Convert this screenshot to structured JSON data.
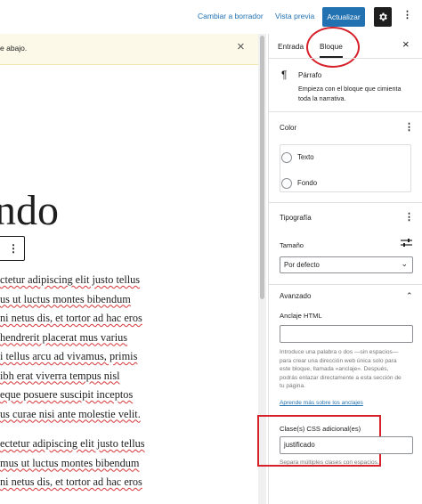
{
  "topbar": {
    "switch_draft": "Cambiar a borrador",
    "preview": "Vista previa",
    "update": "Actualizar"
  },
  "notice": {
    "text": "e abajo.",
    "close": "×"
  },
  "editor": {
    "heading": "ndo",
    "paragraph1": [
      "ctetur adipiscing elit justo tellus",
      "us ut luctus montes bibendum",
      "ni netus dis, et tortor ad hac eros",
      " hendrerit placerat mus varius",
      "i tellus arcu ad vivamus, primis",
      "ibh erat viverra tempus nisl",
      "eque posuere suscipit inceptos",
      "us curae nisi ante molestie velit."
    ],
    "paragraph2": [
      "ectetur adipiscing elit justo tellus",
      "mus ut luctus montes bibendum",
      "ni netus dis, et tortor ad hac eros"
    ]
  },
  "sidebar": {
    "tabs": {
      "entry": "Entrada",
      "block": "Bloque"
    },
    "close": "×",
    "block_card": {
      "icon": "¶",
      "title": "Párrafo",
      "description": [
        "Empieza con el bloque que cimienta",
        "toda la narrativa."
      ]
    },
    "color": {
      "label": "Color",
      "options": [
        "Texto",
        "Fondo"
      ]
    },
    "typography": {
      "label": "Tipografía",
      "size_label": "Tamaño",
      "size_value": "Por defecto"
    },
    "advanced": {
      "label": "Avanzado",
      "anchor_label": "Anclaje HTML",
      "anchor_help": [
        "Introduce una palabra o dos —sin espacios—",
        "para crear una dirección web única solo para",
        "este bloque, llamada «anclaje». Después,",
        "podrás enlazar directamente a esta sección de",
        "tu página."
      ],
      "anchor_link": "Aprende más sobre los anclajes",
      "css_label": "Clase(s) CSS adicional(es)",
      "css_value": "justificado",
      "css_help": "Separa múltiples clases con espacios."
    }
  },
  "colors": {
    "accent": "#2271b1",
    "annotation": "#d6202a",
    "notice_bg": "#fcf9e8"
  }
}
